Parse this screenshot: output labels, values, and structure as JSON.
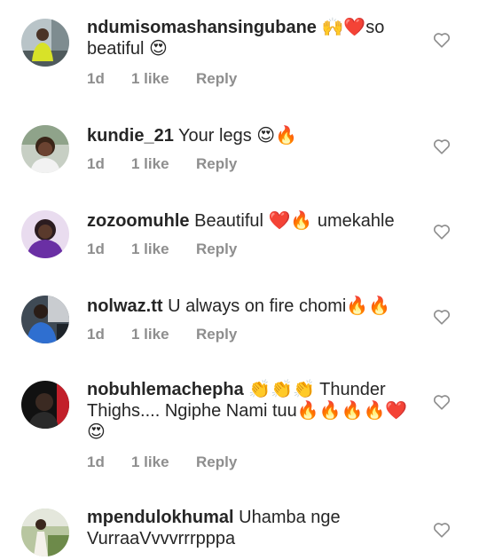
{
  "comments": [
    {
      "username": "ndumisomashansingubane",
      "text": "🙌❤️so beatiful 😍",
      "time": "1d",
      "likes": "1 like",
      "reply": "Reply"
    },
    {
      "username": "kundie_21",
      "text": "Your legs 😍🔥",
      "time": "1d",
      "likes": "1 like",
      "reply": "Reply"
    },
    {
      "username": "zozoomuhle",
      "text": "Beautiful ❤️🔥 umekahle",
      "time": "1d",
      "likes": "1 like",
      "reply": "Reply"
    },
    {
      "username": "nolwaz.tt",
      "text": "U always on fire chomi🔥🔥",
      "time": "1d",
      "likes": "1 like",
      "reply": "Reply"
    },
    {
      "username": "nobuhlemachepha",
      "text": "👏👏👏 Thunder Thighs.... Ngiphe Nami tuu🔥🔥🔥🔥❤️😍",
      "time": "1d",
      "likes": "1 like",
      "reply": "Reply"
    },
    {
      "username": "mpendulokhumal",
      "text": "Uhamba nge VurraaVvvvrrrpppa",
      "time": "",
      "likes": "",
      "reply": ""
    }
  ],
  "icons": {
    "like": "heart-outline-icon"
  },
  "colors": {
    "text": "#262626",
    "secondary": "#8e8e8e",
    "background": "#ffffff"
  }
}
